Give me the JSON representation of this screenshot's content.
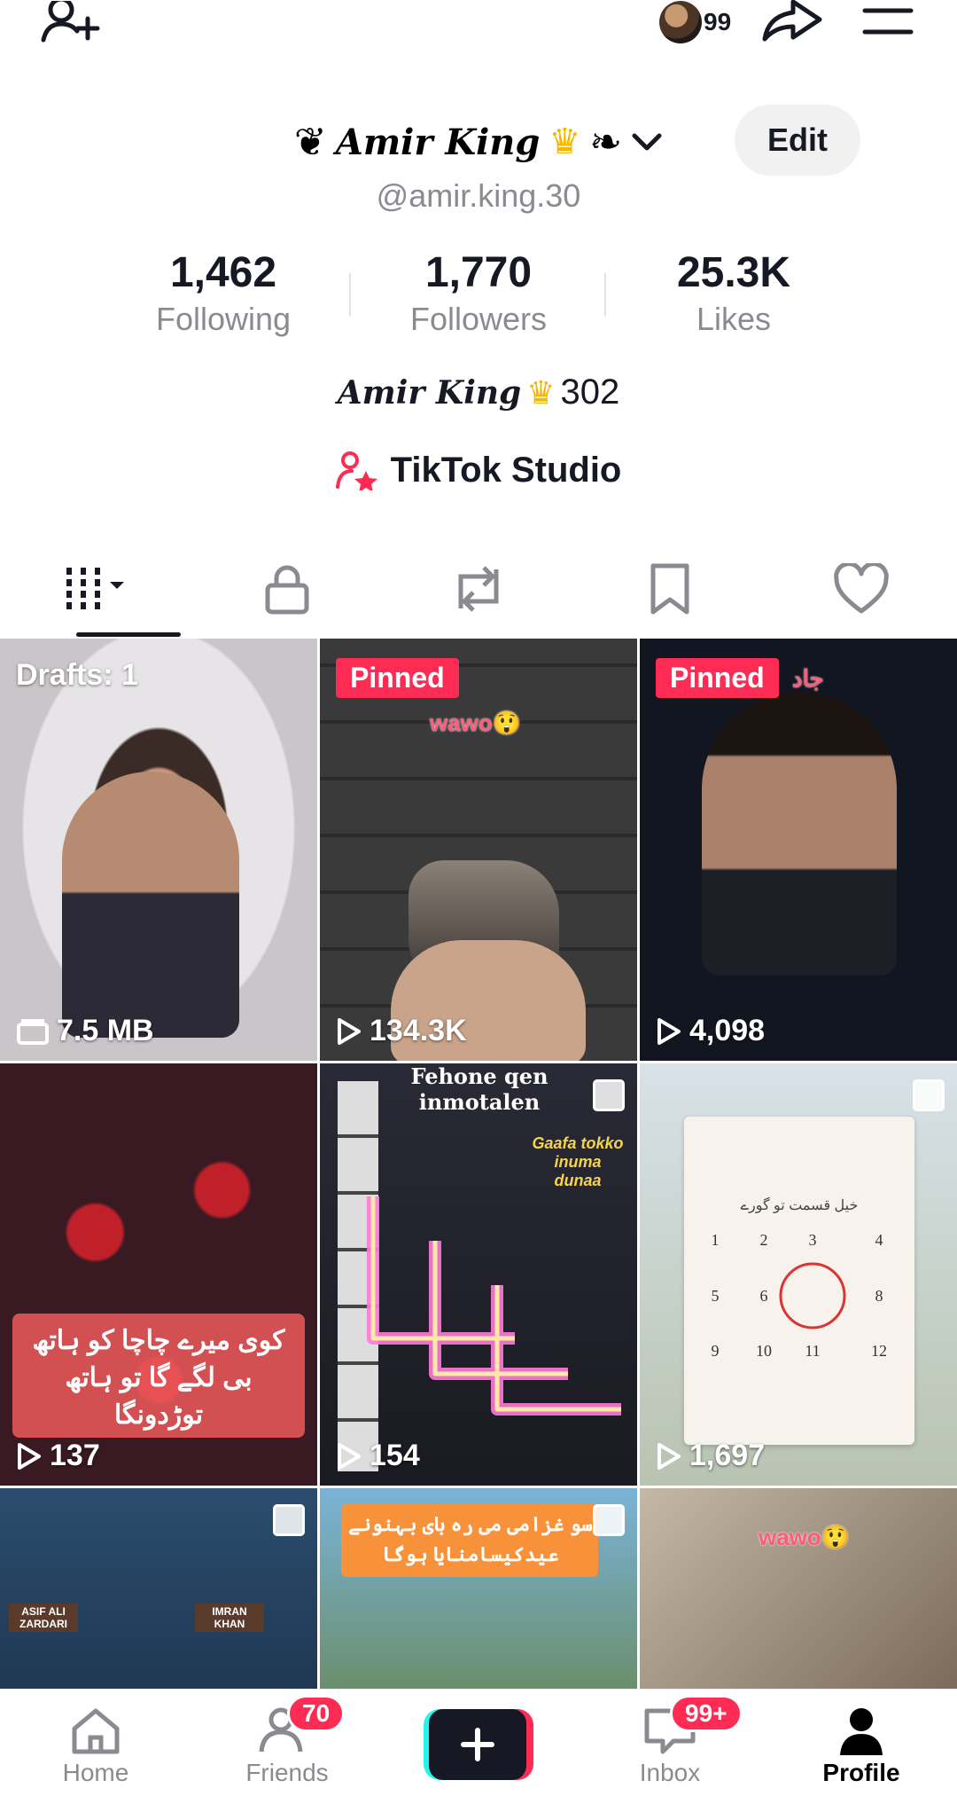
{
  "header": {
    "notification_count": "99"
  },
  "profile": {
    "name": "Amir King",
    "edit_label": "Edit",
    "handle": "@amir.king.30",
    "stats": [
      {
        "value": "1,462",
        "label": "Following"
      },
      {
        "value": "1,770",
        "label": "Followers"
      },
      {
        "value": "25.3K",
        "label": "Likes"
      }
    ],
    "bio_name": "Amir King",
    "bio_number": "302",
    "studio_label": "TikTok Studio"
  },
  "videos": [
    {
      "tag": "Drafts: 1",
      "count": "7.5 MB"
    },
    {
      "tag": "Pinned",
      "caption": "wawo😲",
      "count": "134.3K"
    },
    {
      "tag": "Pinned",
      "caption": "جاد",
      "count": "4,098"
    },
    {
      "caption": "کوی میرے چاچا کو ہاتھ بی لگے گا تو ہاتھ توڑدونگا",
      "count": "137"
    },
    {
      "caption": "Fehone qen inmotalen",
      "caption2": "Gaafa tokko inuma dunaa",
      "count": "154"
    },
    {
      "caption": "خیل قسمت تو گورے",
      "count": "1,697"
    },
    {
      "caption": "ASIF ALI ZARDARI",
      "caption2": "IMRAN KHAN"
    },
    {
      "caption": "سو غزامی می رہ بای بہنونے عیدکیسامنایا ہوگا"
    },
    {
      "caption": "wawo😲"
    }
  ],
  "nav": {
    "items": [
      {
        "label": "Home"
      },
      {
        "label": "Friends",
        "badge": "70"
      },
      {
        "label": ""
      },
      {
        "label": "Inbox",
        "badge": "99+"
      },
      {
        "label": "Profile"
      }
    ]
  },
  "colors": {
    "accent": "#fe2c55",
    "cyan": "#25f4ee"
  }
}
